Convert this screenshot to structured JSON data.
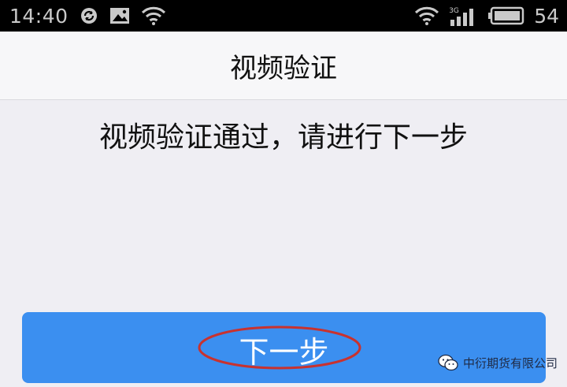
{
  "status_bar": {
    "time": "14:40",
    "network_type": "3G",
    "battery_level": "54",
    "icons": [
      "sync-icon",
      "image-notification-icon",
      "wifi-icon",
      "wifi-icon",
      "signal-icon",
      "battery-icon"
    ]
  },
  "nav": {
    "title": "视频验证"
  },
  "main": {
    "message": "视频验证通过，请进行下一步"
  },
  "button": {
    "next_label": "下一步",
    "color": "#3b8ff0",
    "annotation_color": "#c8322f"
  },
  "watermark": {
    "text": "中衍期货有限公司",
    "icon": "wechat-icon"
  }
}
